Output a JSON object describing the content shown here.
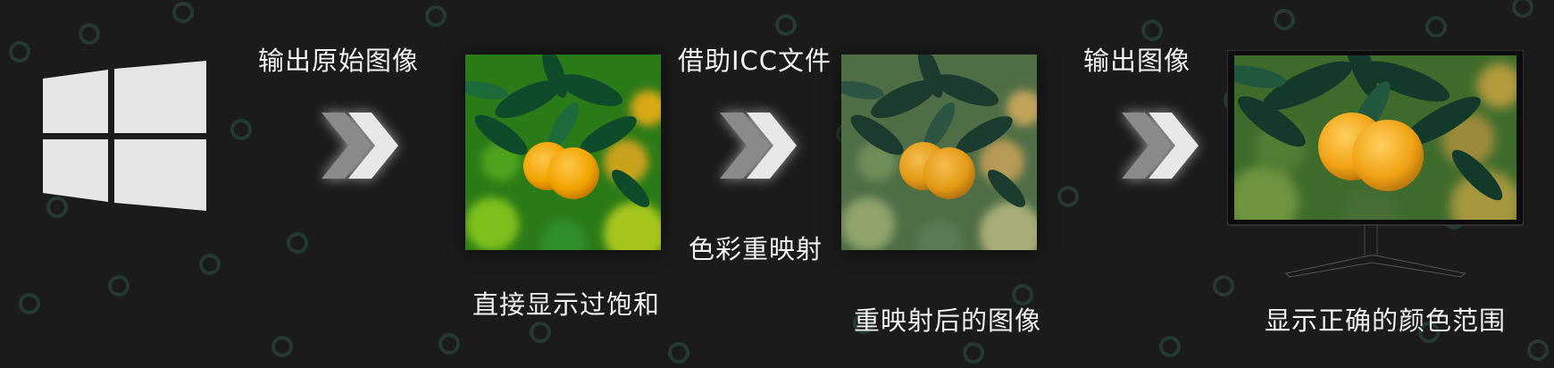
{
  "steps": {
    "label1": "输出原始图像",
    "label2": "借助ICC文件",
    "label3": "输出图像",
    "caption1": "直接显示过饱和",
    "caption2": "色彩重映射",
    "caption3": "重映射后的图像",
    "caption4": "显示正确的颜色范围"
  },
  "colors": {
    "background": "#1b1b1b",
    "ring": "#2d4a3b",
    "text": "#f2f2f2",
    "logo": "#e6e6e6"
  },
  "icons": [
    "windows-logo-icon",
    "double-chevron-icon",
    "monitor-icon"
  ]
}
